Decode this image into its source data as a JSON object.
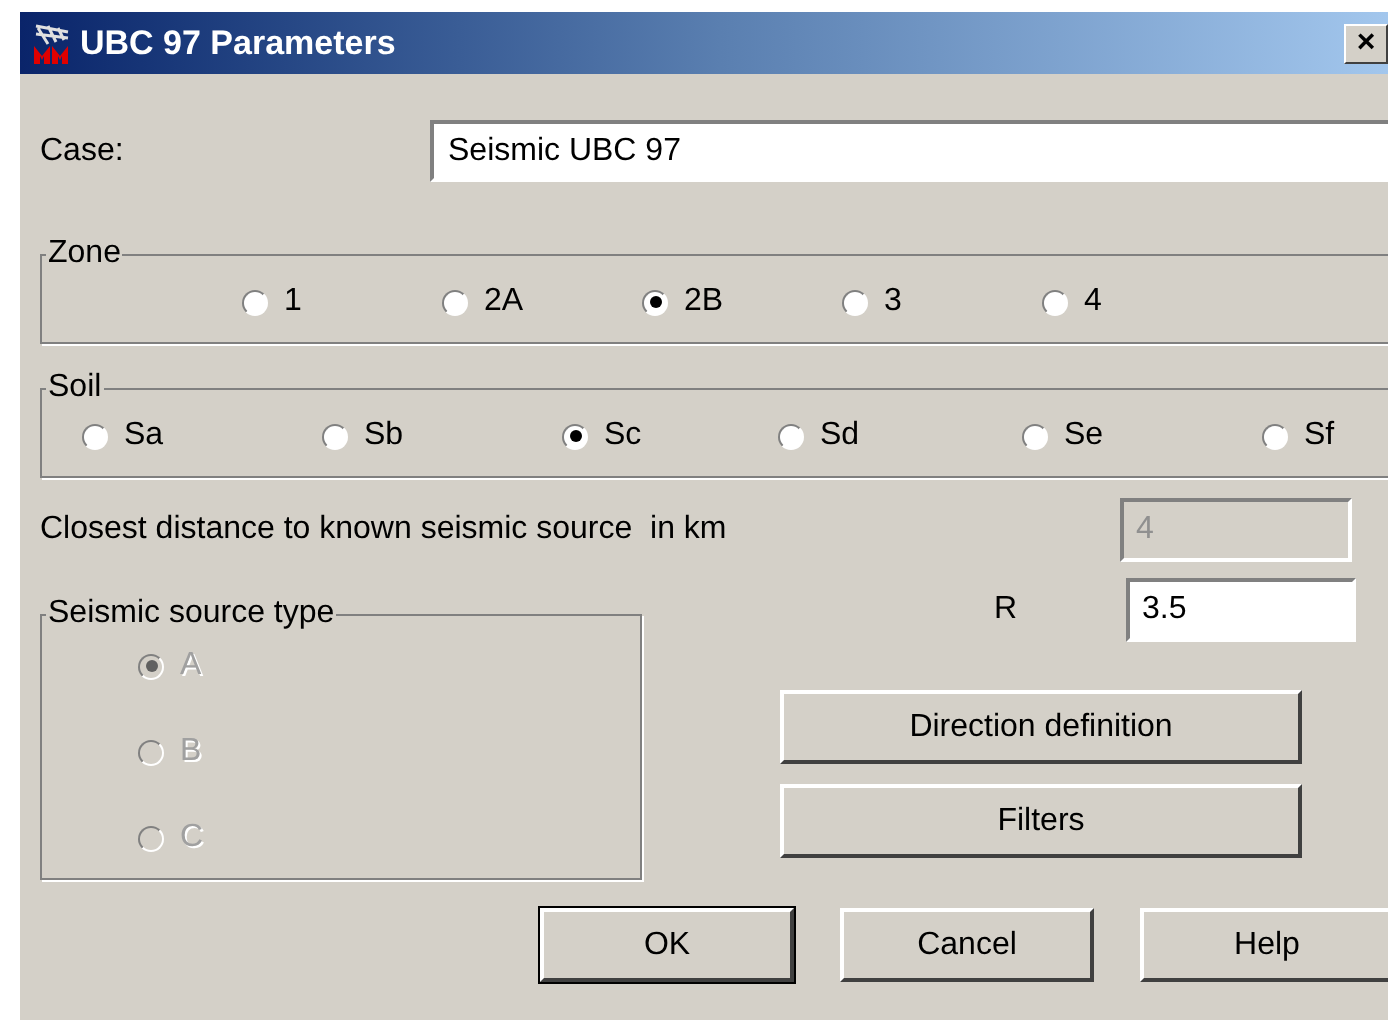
{
  "window": {
    "title": "UBC 97 Parameters",
    "close": "×"
  },
  "case": {
    "label": "Case:",
    "value": "Seismic UBC 97"
  },
  "zone": {
    "title": "Zone",
    "options": [
      {
        "label": "1",
        "selected": false
      },
      {
        "label": "2A",
        "selected": false
      },
      {
        "label": "2B",
        "selected": true
      },
      {
        "label": "3",
        "selected": false
      },
      {
        "label": "4",
        "selected": false
      }
    ]
  },
  "soil": {
    "title": "Soil",
    "options": [
      {
        "label": "Sa",
        "selected": false
      },
      {
        "label": "Sb",
        "selected": false
      },
      {
        "label": "Sc",
        "selected": true
      },
      {
        "label": "Sd",
        "selected": false
      },
      {
        "label": "Se",
        "selected": false
      },
      {
        "label": "Sf",
        "selected": false
      }
    ]
  },
  "distance": {
    "label": "Closest distance to known seismic source  in km",
    "value": "4",
    "disabled": true
  },
  "source_type": {
    "title": "Seismic source type",
    "disabled": true,
    "options": [
      {
        "label": "A",
        "selected": true
      },
      {
        "label": "B",
        "selected": false
      },
      {
        "label": "C",
        "selected": false
      }
    ]
  },
  "r": {
    "label": "R",
    "value": "3.5",
    "disabled": false
  },
  "side_buttons": [
    "Direction definition",
    "Filters"
  ],
  "buttons": [
    {
      "label": "OK",
      "default": true
    },
    {
      "label": "Cancel",
      "default": false
    },
    {
      "label": "Help",
      "default": false
    }
  ]
}
